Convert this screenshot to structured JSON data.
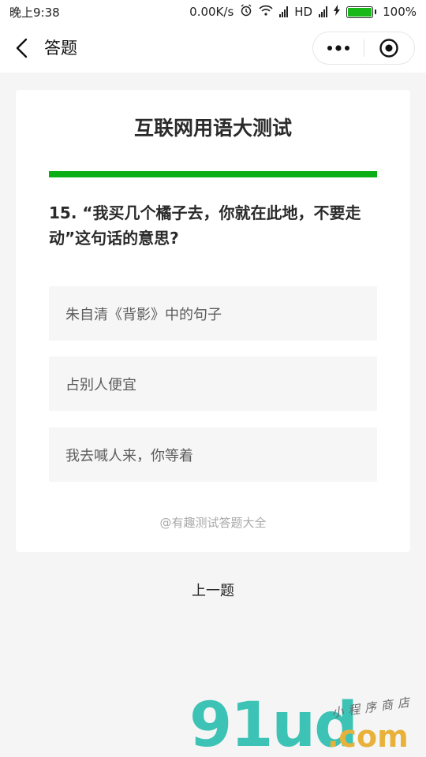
{
  "status_bar": {
    "time": "晚上9:38",
    "net_speed": "0.00K/s",
    "network": "HD",
    "battery": "100%"
  },
  "nav": {
    "back_icon": "chevron-left-icon",
    "title": "答题",
    "more_icon": "more-dots-icon",
    "close_icon": "target-circle-icon"
  },
  "quiz": {
    "title": "互联网用语大测试",
    "progress_fraction": 1.0,
    "question": "15. “我买几个橘子去，你就在此地，不要走动”这句话的意思?",
    "options": [
      "朱自清《背影》中的句子",
      "占别人便宜",
      "我去喊人来，你等着"
    ],
    "credit": "@有趣测试答题大全"
  },
  "prev_label": "上一题",
  "watermark": {
    "brand": "91ud",
    "domain": ".com",
    "tagline": "小程序商店"
  },
  "colors": {
    "progress": "#0aaf15",
    "battery": "#17b817",
    "option_bg": "#f6f6f6"
  }
}
